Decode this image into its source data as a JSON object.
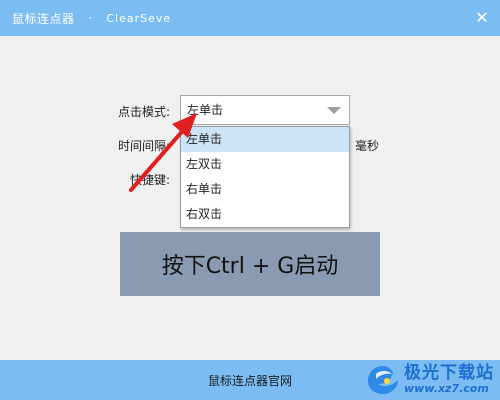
{
  "window": {
    "title": "鼠标连点器",
    "separator": "·",
    "subtitle": "ClearSeve",
    "close_icon": "close-icon",
    "accent_color": "#7bbcf2"
  },
  "form": {
    "click_mode_label": "点击模式:",
    "interval_label": "时间间隔:",
    "hotkey_label": "快捷键:",
    "interval_unit": "毫秒",
    "click_mode_value": "左单击",
    "options": [
      "左单击",
      "左双击",
      "右单击",
      "右双击"
    ],
    "selected_index": 0
  },
  "start_button": {
    "label": "按下Ctrl + G启动",
    "color": "#8b9ab3"
  },
  "footer": {
    "link_label": "鼠标连点器官网"
  },
  "watermark": {
    "brand": "极光下载站",
    "url": "www.xz7.com"
  }
}
